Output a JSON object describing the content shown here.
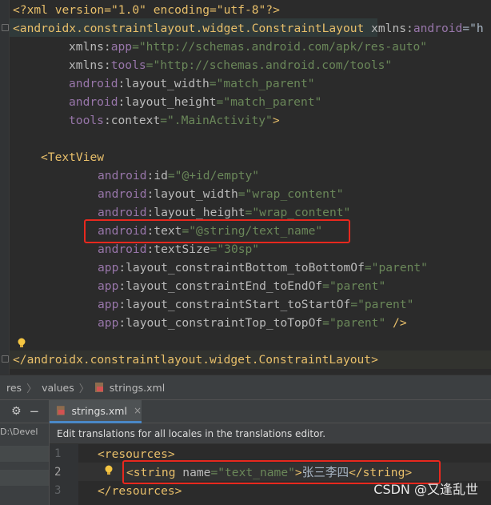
{
  "top_editor": {
    "lines": [
      {
        "parts": [
          {
            "c": "t-decl",
            "t": "<?xml version=\"1.0\" encoding=\"utf-8\"?>"
          }
        ]
      },
      {
        "parts": [
          {
            "c": "t-tag",
            "t": "<androidx.constraintlayout.widget.ConstraintLayout"
          },
          {
            "c": "t-attr",
            "t": " xmlns:"
          },
          {
            "c": "t-ns",
            "t": "android"
          },
          {
            "c": "t-punc",
            "t": "=\"h"
          }
        ]
      },
      {
        "parts": [
          {
            "c": "t-attr",
            "t": "xmlns:"
          },
          {
            "c": "t-ns",
            "t": "app"
          },
          {
            "c": "t-str",
            "t": "=\"http://schemas.android.com/apk/res-auto\""
          }
        ]
      },
      {
        "parts": [
          {
            "c": "t-attr",
            "t": "xmlns:"
          },
          {
            "c": "t-ns",
            "t": "tools"
          },
          {
            "c": "t-str",
            "t": "=\"http://schemas.android.com/tools\""
          }
        ]
      },
      {
        "parts": [
          {
            "c": "t-ns",
            "t": "android"
          },
          {
            "c": "t-attr",
            "t": ":layout_width"
          },
          {
            "c": "t-str",
            "t": "=\"match_parent\""
          }
        ]
      },
      {
        "parts": [
          {
            "c": "t-ns",
            "t": "android"
          },
          {
            "c": "t-attr",
            "t": ":layout_height"
          },
          {
            "c": "t-str",
            "t": "=\"match_parent\""
          }
        ]
      },
      {
        "parts": [
          {
            "c": "t-ns",
            "t": "tools"
          },
          {
            "c": "t-attr",
            "t": ":context"
          },
          {
            "c": "t-str",
            "t": "=\".MainActivity\""
          },
          {
            "c": "t-tag",
            "t": ">"
          }
        ]
      },
      {
        "parts": [
          {
            "c": "t-tag",
            "t": "<TextView"
          }
        ]
      },
      {
        "parts": [
          {
            "c": "t-ns",
            "t": "android"
          },
          {
            "c": "t-attr",
            "t": ":id"
          },
          {
            "c": "t-str",
            "t": "=\"@+id/empty\""
          }
        ]
      },
      {
        "parts": [
          {
            "c": "t-ns",
            "t": "android"
          },
          {
            "c": "t-attr",
            "t": ":layout_width"
          },
          {
            "c": "t-str",
            "t": "=\"wrap_content\""
          }
        ]
      },
      {
        "parts": [
          {
            "c": "t-ns",
            "t": "android"
          },
          {
            "c": "t-attr",
            "t": ":layout_height"
          },
          {
            "c": "t-str",
            "t": "=\"wrap_content\""
          }
        ]
      },
      {
        "parts": [
          {
            "c": "t-ns",
            "t": "android"
          },
          {
            "c": "t-attr",
            "t": ":text"
          },
          {
            "c": "t-str",
            "t": "=\"@string/text_name\""
          }
        ]
      },
      {
        "parts": [
          {
            "c": "t-ns",
            "t": "android"
          },
          {
            "c": "t-attr",
            "t": ":textSize"
          },
          {
            "c": "t-str",
            "t": "=\"30sp\""
          }
        ]
      },
      {
        "parts": [
          {
            "c": "t-ns",
            "t": "app"
          },
          {
            "c": "t-attr",
            "t": ":layout_constraintBottom_toBottomOf"
          },
          {
            "c": "t-str",
            "t": "=\"parent\""
          }
        ]
      },
      {
        "parts": [
          {
            "c": "t-ns",
            "t": "app"
          },
          {
            "c": "t-attr",
            "t": ":layout_constraintEnd_toEndOf"
          },
          {
            "c": "t-str",
            "t": "=\"parent\""
          }
        ]
      },
      {
        "parts": [
          {
            "c": "t-ns",
            "t": "app"
          },
          {
            "c": "t-attr",
            "t": ":layout_constraintStart_toStartOf"
          },
          {
            "c": "t-str",
            "t": "=\"parent\""
          }
        ]
      },
      {
        "parts": [
          {
            "c": "t-ns",
            "t": "app"
          },
          {
            "c": "t-attr",
            "t": ":layout_constraintTop_toTopOf"
          },
          {
            "c": "t-str",
            "t": "=\"parent\""
          },
          {
            "c": "t-tag",
            "t": " />"
          }
        ]
      },
      {
        "parts": [
          {
            "c": "t-tag",
            "t": "</androidx.constraintlayout.widget.ConstraintLayout>"
          }
        ]
      }
    ]
  },
  "breadcrumb": {
    "items": [
      "res",
      "values",
      "strings.xml"
    ]
  },
  "side_panel": {
    "path_label": "D:\\Devel"
  },
  "bottom_editor": {
    "tab_label": "strings.xml",
    "tab_close": "×",
    "notice": "Edit translations for all locales in the translations editor.",
    "line_numbers": [
      "1",
      "2",
      "3"
    ],
    "lines": [
      {
        "parts": [
          {
            "c": "t-tag",
            "t": "<resources>"
          }
        ]
      },
      {
        "parts": [
          {
            "c": "t-tag",
            "t": "<string"
          },
          {
            "c": "t-attr",
            "t": " name"
          },
          {
            "c": "t-str",
            "t": "=\"text_name\""
          },
          {
            "c": "t-tag",
            "t": ">"
          },
          {
            "c": "t-text",
            "t": "张三李四"
          },
          {
            "c": "t-tag",
            "t": "</string>"
          }
        ]
      },
      {
        "parts": [
          {
            "c": "t-tag",
            "t": "</resources>"
          }
        ]
      }
    ]
  },
  "watermark": "CSDN @又逢乱世",
  "colors": {
    "tag": "#e8bf6a",
    "namespace": "#9876aa",
    "string": "#6a8759",
    "attribute": "#bababa",
    "highlight_box": "#e8281e",
    "active_tab_underline": "#4a88c7"
  }
}
